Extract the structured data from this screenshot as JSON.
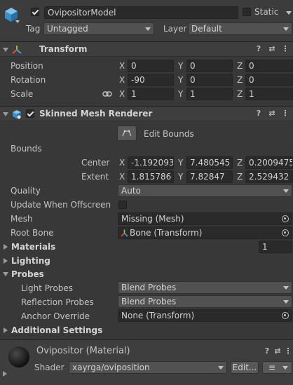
{
  "object": {
    "active": true,
    "name": "OvipositorModel",
    "static_label": "Static",
    "static_checked": false,
    "tag_label": "Tag",
    "tag_value": "Untagged",
    "layer_label": "Layer",
    "layer_value": "Default"
  },
  "transform": {
    "title": "Transform",
    "position": {
      "label": "Position",
      "x": "0",
      "y": "0",
      "z": "0"
    },
    "rotation": {
      "label": "Rotation",
      "x": "-90",
      "y": "0",
      "z": "0"
    },
    "scale": {
      "label": "Scale",
      "x": "1",
      "y": "1",
      "z": "1"
    }
  },
  "axes": {
    "x": "X",
    "y": "Y",
    "z": "Z"
  },
  "renderer": {
    "title": "Skinned Mesh Renderer",
    "enabled": true,
    "edit_bounds_label": "Edit Bounds",
    "bounds_label": "Bounds",
    "center": {
      "label": "Center",
      "x": "-1.192093",
      "y": "7.480545",
      "z": "0.2009475"
    },
    "extent": {
      "label": "Extent",
      "x": "1.815786",
      "y": "7.82847",
      "z": "2.529432"
    },
    "quality_label": "Quality",
    "quality_value": "Auto",
    "update_offscreen_label": "Update When Offscreen",
    "update_offscreen_checked": false,
    "mesh_label": "Mesh",
    "mesh_value": "Missing (Mesh)",
    "root_bone_label": "Root Bone",
    "root_bone_value": "Bone (Transform)",
    "materials_label": "Materials",
    "materials_count": "1",
    "lighting_label": "Lighting",
    "probes_label": "Probes",
    "light_probes_label": "Light Probes",
    "light_probes_value": "Blend Probes",
    "reflection_probes_label": "Reflection Probes",
    "reflection_probes_value": "Blend Probes",
    "anchor_override_label": "Anchor Override",
    "anchor_override_value": "None (Transform)",
    "additional_settings_label": "Additional Settings"
  },
  "material": {
    "title": "Ovipositor (Material)",
    "shader_label": "Shader",
    "shader_value": "xayrga/oviposition",
    "edit_label": "Edit...",
    "menu_glyph": "≡"
  },
  "header_icons": {
    "help": "?",
    "presets": "⇄",
    "more": "⋮"
  },
  "colors": {
    "background": "#383838",
    "header": "#3e3e3e",
    "field": "#2a2a2a",
    "accent_red": "#e8493a",
    "accent_green": "#7ad04b",
    "accent_blue": "#4a9ad8"
  }
}
